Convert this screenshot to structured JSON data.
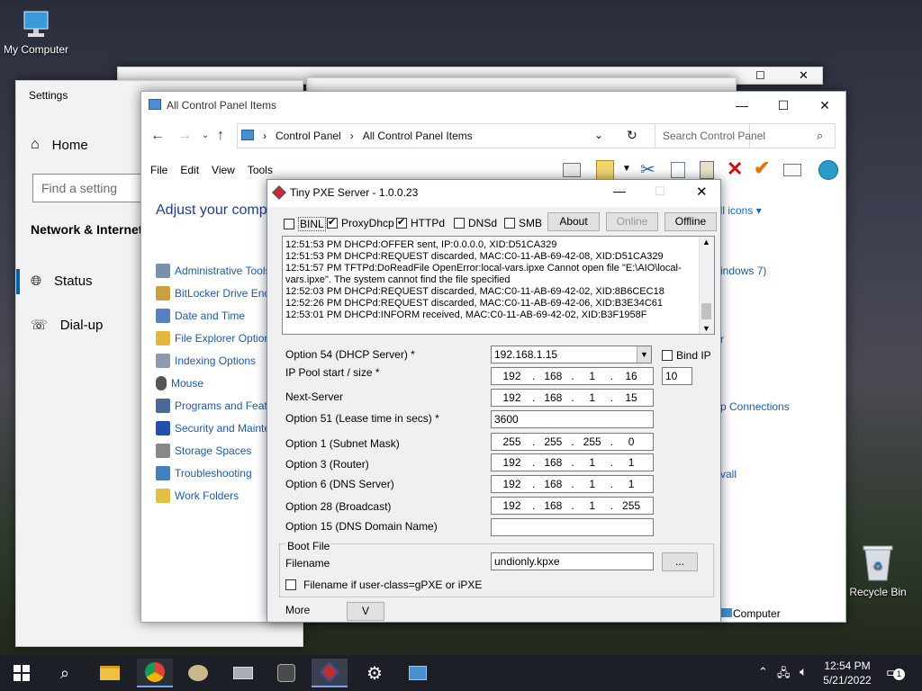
{
  "desktop": {
    "icons": [
      {
        "label": "My Computer"
      },
      {
        "label": "Recycle Bin"
      }
    ]
  },
  "settings": {
    "title": "Settings",
    "home": "Home",
    "search_placeholder": "Find a setting",
    "section": "Network & Internet",
    "items": [
      {
        "label": "Status"
      },
      {
        "label": "Dial-up"
      }
    ]
  },
  "control_panel": {
    "title": "All Control Panel Items",
    "breadcrumb": [
      "Control Panel",
      "All Control Panel Items"
    ],
    "search_placeholder": "Search Control Panel",
    "menu": [
      "File",
      "Edit",
      "View",
      "Tools"
    ],
    "heading": "Adjust your comp",
    "view_by": "all icons ▾",
    "items": [
      {
        "label": "Administrative Tools",
        "color": "#7a8fa8"
      },
      {
        "label": "BitLocker Drive Encr",
        "color": "#c8a040"
      },
      {
        "label": "Date and Time",
        "color": "#5a7fc0"
      },
      {
        "label": "File Explorer Option",
        "color": "#e0b840"
      },
      {
        "label": "Indexing Options",
        "color": "#8a9ab0"
      },
      {
        "label": "Mouse",
        "color": "#555555"
      },
      {
        "label": "Programs and Featu",
        "color": "#4a6a9a"
      },
      {
        "label": "Security and Mainte",
        "color": "#2050b0"
      },
      {
        "label": "Storage Spaces",
        "color": "#888888"
      },
      {
        "label": "Troubleshooting",
        "color": "#4080c0"
      },
      {
        "label": "Work Folders",
        "color": "#e0c040"
      }
    ],
    "right_items": [
      "indows 7)",
      "r",
      "p Connections",
      "vall",
      "Computer"
    ]
  },
  "pxe": {
    "title": "Tiny PXE Server - 1.0.0.23",
    "options": [
      {
        "label": "BINL",
        "checked": false
      },
      {
        "label": "ProxyDhcp",
        "checked": true
      },
      {
        "label": "HTTPd",
        "checked": true
      },
      {
        "label": "DNSd",
        "checked": false
      },
      {
        "label": "SMB",
        "checked": false
      }
    ],
    "buttons": {
      "about": "About",
      "online": "Online",
      "offline": "Offline",
      "more": "V",
      "browse": "..."
    },
    "log": [
      "12:51:53 PM DHCPd:OFFER sent, IP:0.0.0.0, XID:D51CA329",
      "12:51:53 PM DHCPd:REQUEST discarded, MAC:C0-11-AB-69-42-08, XID:D51CA329",
      "12:51:57 PM TFTPd:DoReadFile OpenError:local-vars.ipxe Cannot open file \"E:\\AIO\\local-",
      "vars.ipxe\". The system cannot find the file specified",
      "12:52:03 PM DHCPd:REQUEST discarded, MAC:C0-11-AB-69-42-02, XID:8B6CEC18",
      "12:52:26 PM DHCPd:REQUEST discarded, MAC:C0-11-AB-69-42-06, XID:B3E34C61",
      "12:53:01 PM DHCPd:INFORM received, MAC:C0-11-AB-69-42-02, XID:B3F1958F"
    ],
    "opt54_label": "Option 54 (DHCP Server) *",
    "opt54_value": "192.168.1.15",
    "bind_ip": "Bind IP",
    "pool_label": "IP Pool start / size *",
    "pool_ip": [
      "192",
      "168",
      "1",
      "16"
    ],
    "pool_size": "10",
    "next_label": "Next-Server",
    "next_ip": [
      "192",
      "168",
      "1",
      "15"
    ],
    "opt51_label": "Option 51 (Lease time in secs) *",
    "opt51_value": "3600",
    "opt1_label": "Option 1  (Subnet Mask)",
    "opt1_ip": [
      "255",
      "255",
      "255",
      "0"
    ],
    "opt3_label": "Option 3  (Router)",
    "opt3_ip": [
      "192",
      "168",
      "1",
      "1"
    ],
    "opt6_label": "Option 6  (DNS Server)",
    "opt6_ip": [
      "192",
      "168",
      "1",
      "1"
    ],
    "opt28_label": "Option 28 (Broadcast)",
    "opt28_ip": [
      "192",
      "168",
      "1",
      "255"
    ],
    "opt15_label": "Option 15 (DNS Domain Name)",
    "opt15_value": "",
    "boot_group": "Boot File",
    "filename_label": "Filename",
    "filename_value": "undionly.kpxe",
    "gpxe_label": "Filename if user-class=gPXE or iPXE",
    "more_label": "More"
  },
  "taskbar": {
    "time": "12:54 PM",
    "date": "5/21/2022",
    "notifications": "1"
  }
}
